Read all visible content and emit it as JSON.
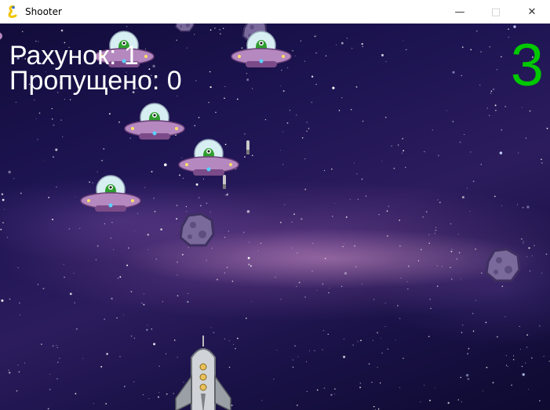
{
  "window": {
    "title": "Shooter",
    "app_icon": "pygame-snake-icon",
    "controls": [
      "minimize-icon",
      "maximize-icon",
      "close-icon"
    ]
  },
  "hud": {
    "score_label": "Рахунок: 1",
    "missed_label": "Пропущено: 0",
    "lives": "3",
    "lives_color": "#00c800",
    "text_color": "#ffffff"
  },
  "entities": {
    "enemy_ufo_count": 6,
    "asteroid_count": 4,
    "bullet_count": 2,
    "player": "rocket"
  }
}
